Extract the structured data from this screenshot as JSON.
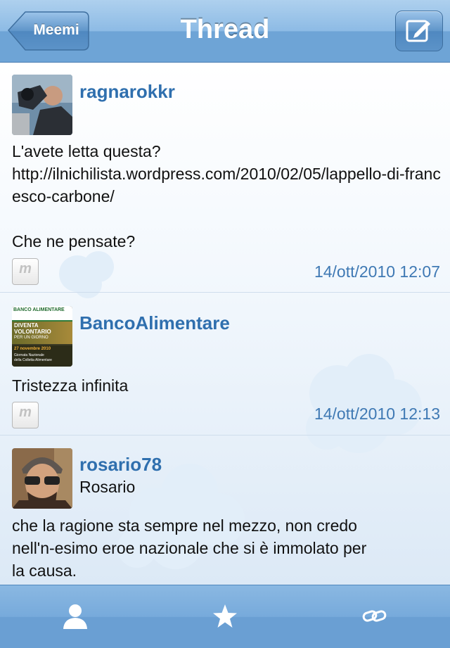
{
  "navbar": {
    "back_label": "Meemi",
    "title": "Thread",
    "compose_icon": "compose-icon"
  },
  "posts": [
    {
      "username": "ragnarokkr",
      "text": "L'avete letta questa?\nhttp://ilnichilista.wordpress.com/2010/02/05/lappello-di-francesco-carbone/\n\nChe ne pensate?",
      "source_icon": "meemi-icon",
      "source_label": "m",
      "timestamp": "14/ott/2010 12:07"
    },
    {
      "username": "BancoAlimentare",
      "avatar_text": {
        "header": "BANCO ALIMENTARE",
        "line1": "DIVENTA",
        "line2": "VOLONTARIO",
        "line3": "PER UN GIORNO",
        "date": "27 novembre 2010",
        "event1": "Giornata Nazionale",
        "event2": "della Colletta Alimentare"
      },
      "text": "Tristezza infinita",
      "source_icon": "meemi-icon",
      "source_label": "m",
      "timestamp": "14/ott/2010 12:13"
    },
    {
      "username": "rosario78",
      "realname": "Rosario",
      "text": "che la ragione sta sempre nel mezzo, non credo nell'n-esimo eroe nazionale che si è immolato per la causa."
    }
  ],
  "tabbar": {
    "tabs": [
      {
        "icon": "person-icon"
      },
      {
        "icon": "star-icon"
      },
      {
        "icon": "link-icon"
      }
    ]
  },
  "colors": {
    "navbar": "#8dbbe5",
    "username": "#2f6fae",
    "timestamp": "#3f79b4",
    "tabbar": "#77aadb"
  }
}
